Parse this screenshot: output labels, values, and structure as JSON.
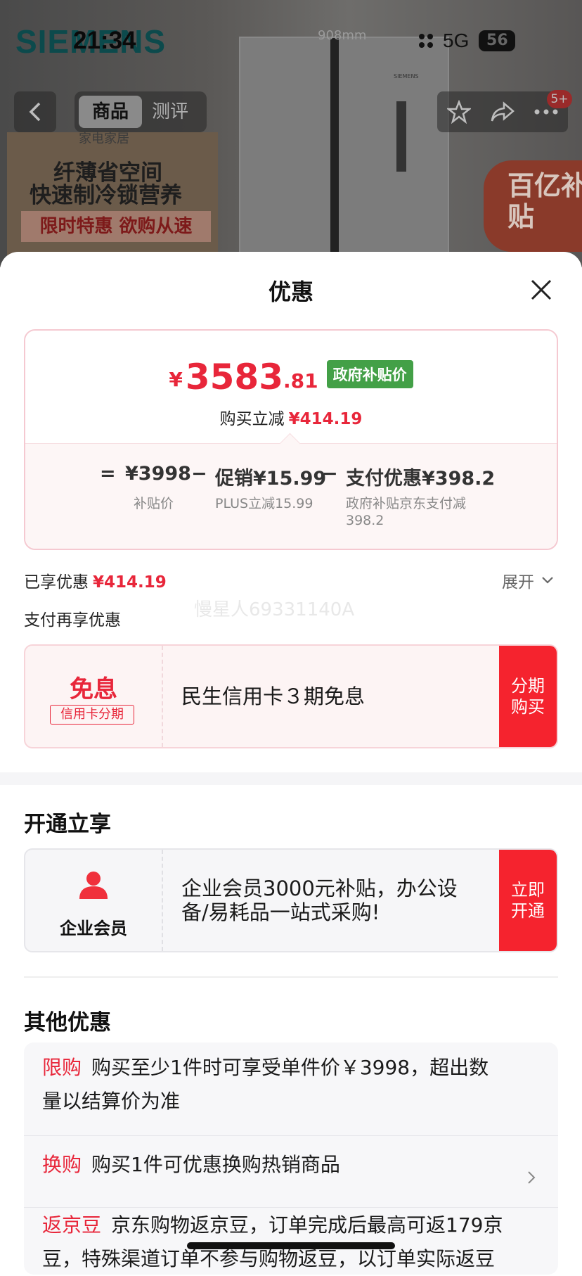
{
  "background": {
    "brand": "SIEMENS",
    "dimension": "908mm",
    "fridge_brand": "SIEMENS",
    "promo_tag": "家电家居",
    "promo_line1": "纤薄省空间",
    "promo_line2": "快速制冷锁营养",
    "promo_banner": "限时特惠 欲购从速",
    "subsidy_badge": "百亿补贴"
  },
  "status_bar": {
    "time": "21:34",
    "network": "5G",
    "battery": "56"
  },
  "top_nav": {
    "back_icon": "chevron-left-icon",
    "tab_product": "商品",
    "tab_review": "测评",
    "badge": "5+"
  },
  "sheet": {
    "title": "优惠",
    "price": {
      "currency": "¥",
      "main": "3583",
      "decimal": ".81",
      "tag": "政府补贴价",
      "reduce_label": "购买立减",
      "reduce_amount": "¥414.19"
    },
    "formula": {
      "eq": "=",
      "base": "¥3998",
      "base_label": "补贴价",
      "minus1": "−",
      "promo": "促销¥15.99",
      "promo_label": "PLUS立减15.99",
      "minus2": "−",
      "pay": "支付优惠¥398.2",
      "pay_label_line1": "政府补贴京东支付减",
      "pay_label_line2": "398.2"
    },
    "enjoyed_label": "已享优惠",
    "enjoyed_amount": "¥414.19",
    "expand_label": "展开",
    "pay_more_label": "支付再享优惠",
    "watermark": "慢星人69331140A",
    "installment": {
      "big": "免息",
      "tag": "信用卡分期",
      "desc": "民生信用卡３期免息",
      "btn_line1": "分期",
      "btn_line2": "购买"
    },
    "open_section_title": "开通立享",
    "member": {
      "icon": "person-icon",
      "label": "企业会员",
      "desc_line1": "企业会员3000元补贴，办公设",
      "desc_line2": "备/易耗品一站式采购!",
      "btn_line1": "立即",
      "btn_line2": "开通"
    },
    "other_section_title": "其他优惠",
    "offers": [
      {
        "key": "限购",
        "text_line1": "购买至少1件时可享受单件价￥3998，超出数",
        "text_line2": "量以结算价为准"
      },
      {
        "key": "换购",
        "text_line1": "购买1件可优惠换购热销商品"
      },
      {
        "key": "返京豆",
        "text_line1": "京东购物返京豆，订单完成后最高可返179京",
        "text_line2": "豆，特殊渠道订单不参与购物返豆，以订单实际返豆"
      }
    ]
  },
  "colors": {
    "accent_red": "#e8263a",
    "button_red": "#f5232e",
    "gov_green": "#43a047"
  }
}
